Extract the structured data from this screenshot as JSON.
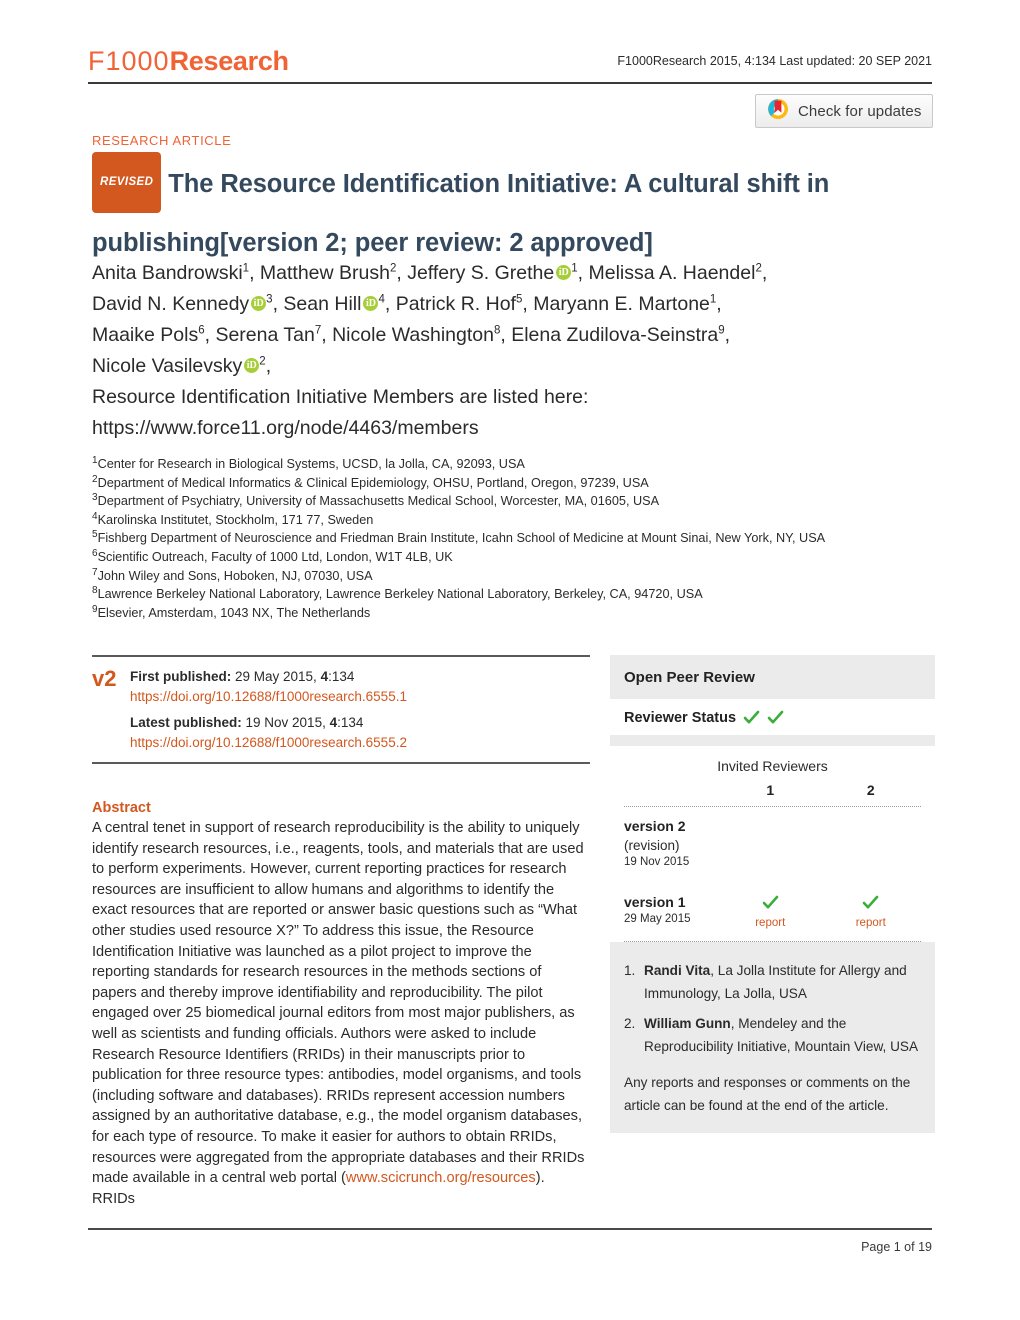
{
  "header": {
    "logo_part1": "F1000",
    "logo_part2": "Research",
    "meta": "F1000Research 2015, 4:134 Last updated: 20 SEP 2021",
    "crossmark_label": "Check for updates"
  },
  "article": {
    "type": "RESEARCH ARTICLE",
    "revised_badge": "REVISED",
    "title_line1": "The Resource Identification Initiative: A cultural shift in",
    "title_line2_main": "publishing",
    "title_line2_version": "[version 2; peer review: 2 approved]"
  },
  "authors": {
    "line1": "Anita Bandrowski",
    "sup1": "1",
    "a2": ", Matthew Brush",
    "sup2": "2",
    "a3": ", Jeffery S. Grethe",
    "sup3": "1",
    "a4": ", Melissa A. Haendel",
    "sup4": "2",
    "a5": ",",
    "b1": "David N. Kennedy",
    "supb1": "3",
    "b2": ", Sean Hill",
    "supb2": "4",
    "b3": ", Patrick R. Hof",
    "supb3": "5",
    "b4": ", Maryann E. Martone",
    "supb4": "1",
    "b5": ",",
    "c1": "Maaike Pols",
    "supc1": "6",
    "c2": ", Serena Tan",
    "supc2": "7",
    "c3": ", Nicole Washington",
    "supc3": "8",
    "c4": ", Elena Zudilova-Seinstra",
    "supc4": "9",
    "c5": ",",
    "d1": "Nicole Vasilevsky",
    "supd1": "2",
    "d2": ",",
    "members_line1": "Resource Identification Initiative Members are listed here:",
    "members_line2": "https://www.force11.org/node/4463/members"
  },
  "affiliations": [
    {
      "sup": "1",
      "text": "Center for Research in Biological Systems, UCSD, la Jolla, CA, 92093, USA"
    },
    {
      "sup": "2",
      "text": "Department of Medical Informatics & Clinical Epidemiology, OHSU, Portland, Oregon, 97239, USA"
    },
    {
      "sup": "3",
      "text": "Department of Psychiatry, University of Massachusetts Medical School, Worcester, MA, 01605, USA"
    },
    {
      "sup": "4",
      "text": "Karolinska Institutet, Stockholm, 171 77, Sweden"
    },
    {
      "sup": "5",
      "text": "Fishberg Department of Neuroscience and Friedman Brain Institute, Icahn School of Medicine at Mount Sinai, New York, NY, USA"
    },
    {
      "sup": "6",
      "text": "Scientific Outreach, Faculty of 1000 Ltd, London, W1T 4LB, UK"
    },
    {
      "sup": "7",
      "text": "John Wiley and Sons, Hoboken, NJ, 07030, USA"
    },
    {
      "sup": "8",
      "text": "Lawrence Berkeley National Laboratory, Lawrence Berkeley National Laboratory, Berkeley, CA, 94720, USA"
    },
    {
      "sup": "9",
      "text": "Elsevier, Amsterdam, 1043 NX, The Netherlands"
    }
  ],
  "publication": {
    "version_marker": "v2",
    "first_label": "First published:",
    "first_value": " 29 May 2015, ",
    "first_vol": "4",
    "first_page": ":134",
    "first_doi": "https://doi.org/10.12688/f1000research.6555.1",
    "latest_label": "Latest published:",
    "latest_value": " 19 Nov 2015, ",
    "latest_vol": "4",
    "latest_page": ":134",
    "latest_doi": "https://doi.org/10.12688/f1000research.6555.2"
  },
  "abstract": {
    "heading": "Abstract",
    "part1": "A central tenet in support of research reproducibility is the ability to uniquely identify research resources, i.e., reagents, tools, and materials that are used to perform experiments. However, current reporting practices for research resources are insufficient to allow humans and algorithms to identify the exact resources that are reported or answer basic questions such as “What other studies used resource X?” To address this issue, the Resource Identification Initiative was launched as a pilot project to improve the reporting standards for research resources in the methods sections of papers and thereby improve identifiability and reproducibility. The pilot engaged over 25 biomedical journal editors from most major publishers, as well as scientists and funding officials. Authors were asked to include Research Resource Identifiers (RRIDs) in their manuscripts prior to publication for three resource types: antibodies, model organisms, and tools (including software and databases). RRIDs represent accession numbers assigned by an authoritative database, e.g., the model organism databases, for each type of resource. To make it easier for authors to obtain RRIDs, resources were aggregated from the appropriate databases and their RRIDs made available in a central web portal (",
    "link": "www.scicrunch.org/resources",
    "part2": "). RRIDs"
  },
  "peer_review": {
    "heading": "Open Peer Review",
    "status_label": "Reviewer Status",
    "status_ticks": 2,
    "table_header": "Invited Reviewers",
    "columns": [
      "1",
      "2"
    ],
    "rows": [
      {
        "name": "version 2",
        "sub": "(revision)",
        "date": "19 Nov 2015",
        "cells": [
          {
            "tick": false,
            "report": ""
          },
          {
            "tick": false,
            "report": ""
          }
        ]
      },
      {
        "name": "version 1",
        "sub": "",
        "date": "29 May 2015",
        "cells": [
          {
            "tick": true,
            "report": "report"
          },
          {
            "tick": true,
            "report": "report"
          }
        ]
      }
    ],
    "reviewers": [
      {
        "num": "1.",
        "name": "Randi Vita",
        "affil": ", La Jolla Institute for Allergy and Immunology, La Jolla, USA"
      },
      {
        "num": "2.",
        "name": "William Gunn",
        "affil": ", Mendeley and the Reproducibility Initiative, Mountain View, USA"
      }
    ],
    "note": "Any reports and responses or comments on the article can be found at the end of the article."
  },
  "footer": {
    "page": "Page 1 of 19"
  },
  "colors": {
    "brand_orange": "#ef6335",
    "badge_orange": "#d2581f",
    "title_blue": "#34495e",
    "orcid_green": "#a6ce39",
    "tick_green": "#3aae3a",
    "panel_gray": "#ebebeb"
  }
}
